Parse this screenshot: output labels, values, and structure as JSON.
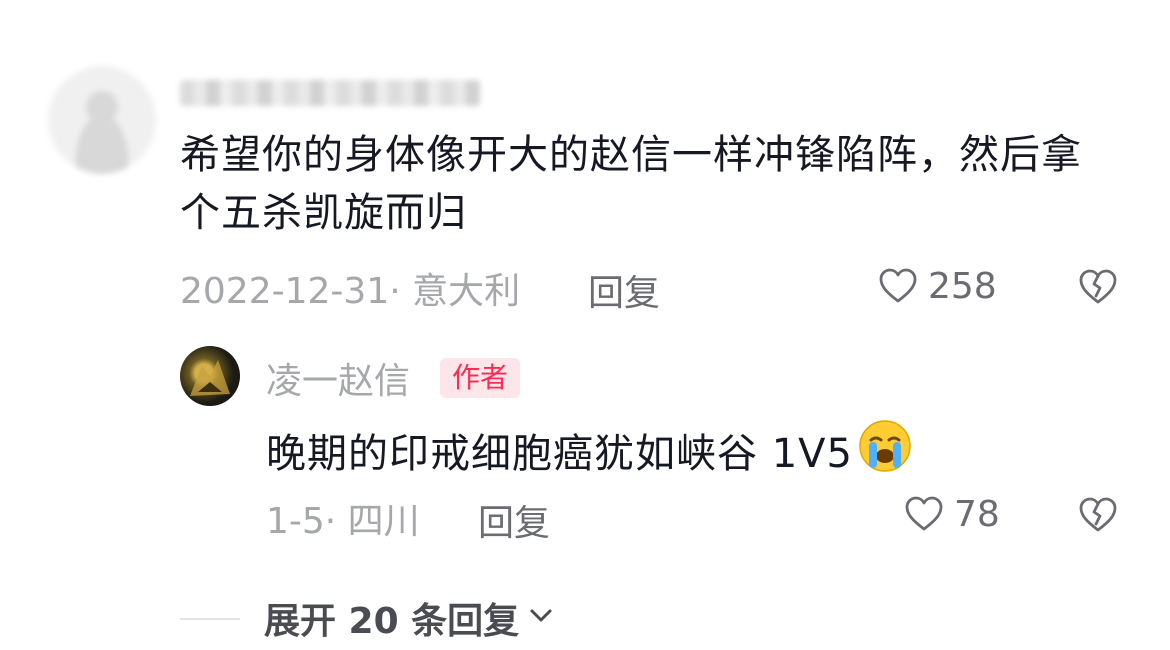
{
  "comment": {
    "text": "希望你的身体像开大的赵信一样冲锋陷阵，然后拿个五杀凯旋而归",
    "meta": "2022-12-31· 意大利",
    "reply_label": "回复",
    "like_count": "258"
  },
  "reply": {
    "username": "凌一赵信",
    "badge": "作者",
    "text": "晚期的印戒细胞癌犹如峡谷 1V5",
    "emoji": "crying-face",
    "meta": "1-5· 四川",
    "reply_label": "回复",
    "like_count": "78"
  },
  "expand": {
    "label": "展开 20 条回复"
  },
  "icons": {
    "like": "heart-outline-icon",
    "dislike": "broken-heart-icon",
    "chevron": "chevron-down-icon"
  },
  "colors": {
    "primary_text": "#161823",
    "secondary_text": "#a6a7ab",
    "action_text": "#6b6c72",
    "badge_bg": "#fde6ea",
    "badge_text": "#fe2c55"
  }
}
